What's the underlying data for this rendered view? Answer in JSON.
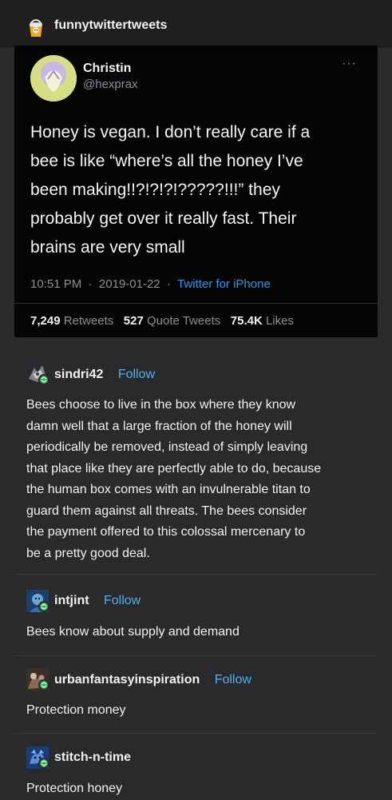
{
  "op": {
    "name": "funnytwittertweets",
    "avatar_icon": "paint-can-icon"
  },
  "tweet": {
    "display_name": "Christin",
    "handle": "@hexprax",
    "more_icon": "more-dots-icon",
    "lines": [
      "Honey is vegan. I don’t really care if a",
      "bee is like “where’s all the honey I’ve",
      "been making!!?!?!?!?????!!!” they",
      "probably get over it really fast. Their",
      "brains are very small"
    ],
    "time": "10:51 PM",
    "date": "2019-01-22",
    "source": "Twitter for iPhone",
    "retweets": "7,249",
    "retweets_label": "Retweets",
    "quotes": "527",
    "quotes_label": "Quote Tweets",
    "likes": "75.4K",
    "likes_label": "Likes"
  },
  "follow_label": "Follow",
  "reblogs": [
    {
      "username": "sindri42",
      "lines": [
        "Bees choose to live in the box where they know",
        "damn well that a large fraction of the honey will",
        "periodically be removed, instead of simply leaving",
        "that place like they are perfectly able to do, because",
        "the human box comes with an invulnerable titan to",
        "guard them against all threats. The bees consider",
        "the payment offered to this colossal mercenary to",
        "be a pretty good deal."
      ]
    },
    {
      "username": "intjint",
      "lines": [
        "Bees know about supply and demand"
      ]
    },
    {
      "username": "urbanfantasyinspiration",
      "lines": [
        "Protection money"
      ]
    },
    {
      "username": "stitch-n-time",
      "lines": [
        "Protection honey"
      ]
    }
  ],
  "colors": {
    "background": "#2a2a2c",
    "tweet_bg": "#050506",
    "link_blue": "#2d98e8",
    "follow_blue": "#4db0f0",
    "reblog_green": "#2eb852"
  }
}
